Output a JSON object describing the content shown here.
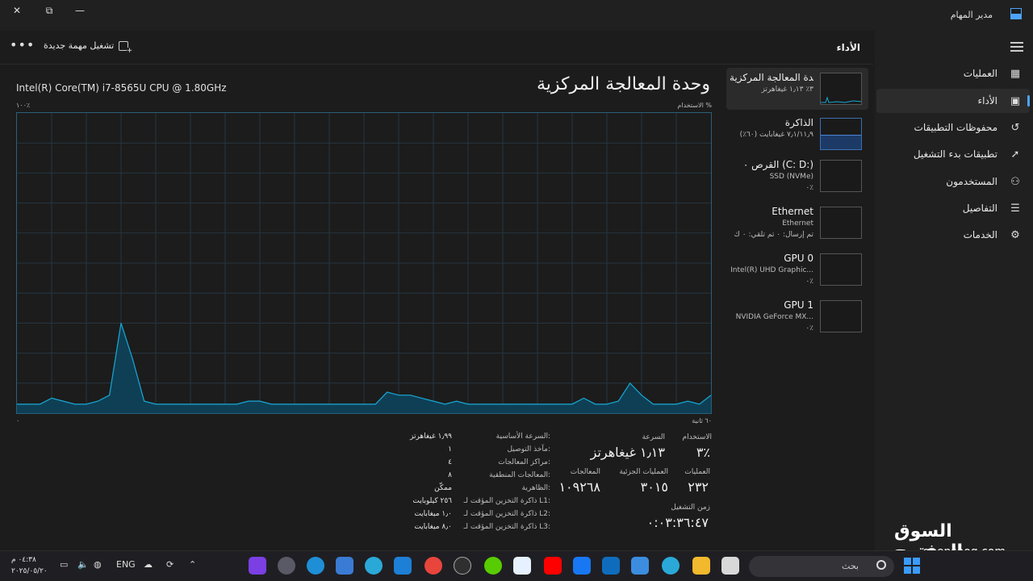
{
  "window": {
    "title": "مدير المهام"
  },
  "header": {
    "page_title": "الأداء",
    "run_task_label": "تشغيل مهمة جديدة",
    "more_label": "•••"
  },
  "nav": {
    "items": [
      {
        "label": "العمليات",
        "icon": "grid-icon"
      },
      {
        "label": "الأداء",
        "icon": "performance-icon",
        "active": true
      },
      {
        "label": "محفوظات التطبيقات",
        "icon": "history-icon"
      },
      {
        "label": "تطبيقات بدء التشغيل",
        "icon": "startup-icon"
      },
      {
        "label": "المستخدمون",
        "icon": "users-icon"
      },
      {
        "label": "التفاصيل",
        "icon": "details-icon"
      },
      {
        "label": "الخدمات",
        "icon": "services-icon"
      }
    ]
  },
  "devices": [
    {
      "name": "وحدة المعالجة المركزية",
      "sub1": "٣٪  ١٫١٣ غيغاهرتز",
      "sub2": ""
    },
    {
      "name": "الذاكرة",
      "sub1": "٧٫١/١١٫٩ غيغابايت (٦٠٪)",
      "sub2": ""
    },
    {
      "name": "القرص ٠ (C: D:)",
      "sub1": "SSD (NVMe)",
      "sub2": "٠٪"
    },
    {
      "name": "Ethernet",
      "sub1": "Ethernet",
      "sub2": "تم إرسال: ٠ تم تلقي: ٠ ك"
    },
    {
      "name": "GPU 0",
      "sub1": "Intel(R) UHD Graphic...",
      "sub2": "٠٪"
    },
    {
      "name": "GPU 1",
      "sub1": "NVIDIA GeForce MX...",
      "sub2": "٠٪"
    }
  ],
  "cpu": {
    "title": "وحدة المعالجة المركزية",
    "model": "Intel(R) Core(TM) i7-8565U CPU @ 1.80GHz",
    "util_axis_label": "الاستخدام %",
    "max_label": "١٠٠٪",
    "time_left_label": "٠",
    "time_right_label": "٦٠ ثانية"
  },
  "chart_data": {
    "type": "area",
    "y_range": [
      0,
      100
    ],
    "x_range_seconds": [
      0,
      60
    ],
    "grid": true,
    "values": [
      3,
      3,
      3,
      5,
      4,
      3,
      3,
      4,
      6,
      30,
      18,
      4,
      3,
      3,
      3,
      3,
      3,
      3,
      3,
      3,
      4,
      4,
      3,
      3,
      3,
      3,
      3,
      3,
      3,
      3,
      3,
      3,
      7,
      6,
      6,
      5,
      4,
      3,
      4,
      3,
      3,
      3,
      3,
      3,
      3,
      3,
      3,
      3,
      3,
      5,
      3,
      3,
      4,
      10,
      6,
      3,
      3,
      3,
      4,
      3,
      6
    ]
  },
  "stats": {
    "utilization_label": "الاستخدام",
    "utilization_value": "٣٪",
    "speed_label": "السرعة",
    "speed_value": "١٫١٣ غيغاهرتز",
    "processes_label": "العمليات",
    "processes_value": "٢٣٢",
    "threads_label": "العمليات الجزئية",
    "threads_value": "٣٠١٥",
    "handles_label": "المعالجات",
    "handles_value": "١٠٩٢٦٨",
    "uptime_label": "زمن التشغيل",
    "uptime_value": "٠:٠٣:٣٦:٤٧"
  },
  "specs": [
    {
      "label": "السرعة الأساسية:",
      "value": "١٫٩٩ غيغاهرتز"
    },
    {
      "label": "مآخذ التوصيل:",
      "value": "١"
    },
    {
      "label": "مراكز المعالجات:",
      "value": "٤"
    },
    {
      "label": "المعالجات المنطقية:",
      "value": "٨"
    },
    {
      "label": "الظاهرية:",
      "value": "ممكّن"
    },
    {
      "label": "ذاكرة التخزين المؤقت لـ L1:",
      "value": "٢٥٦ كيلوبايت"
    },
    {
      "label": "ذاكرة التخزين المؤقت لـ L2:",
      "value": "١٫٠ ميغابايت"
    },
    {
      "label": "ذاكرة التخزين المؤقت لـ L3:",
      "value": "٨٫٠ ميغابايت"
    }
  ],
  "taskbar": {
    "time": "٠٤:٣٨ م",
    "date": "٢٠٢٥/٠٥/٢٠",
    "lang": "ENG",
    "search_placeholder": "بحث"
  },
  "watermark": {
    "arabic": "السوق المفتوح",
    "english": "opensooq.com"
  },
  "colors": {
    "accent": "#4da3ff",
    "graph_line": "#17a9d6",
    "graph_fill": "#0f3f55"
  }
}
